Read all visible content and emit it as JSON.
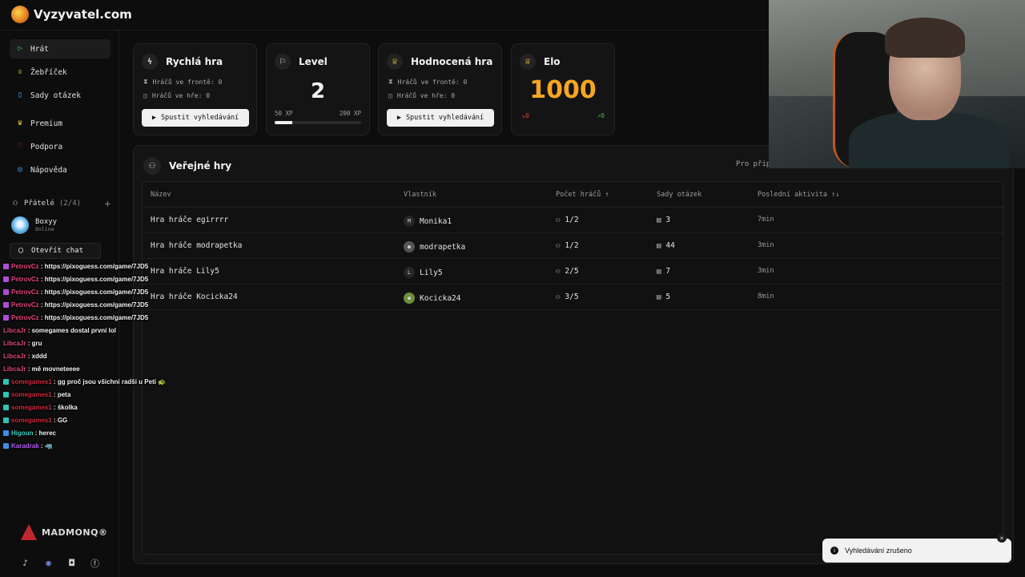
{
  "header": {
    "logo_text": "Vyzyvatel.com"
  },
  "sidebar": {
    "nav": [
      {
        "label": "Hrát",
        "icon": "play-icon"
      },
      {
        "label": "Žebříček",
        "icon": "trophy-icon"
      },
      {
        "label": "Sady otázek",
        "icon": "book-icon"
      },
      {
        "label": "Premium",
        "icon": "crown-icon"
      },
      {
        "label": "Podpora",
        "icon": "heart-icon"
      },
      {
        "label": "Nápověda",
        "icon": "help-icon"
      }
    ],
    "friends": {
      "label": "Přátelé",
      "count": "(2/4)"
    },
    "friend": {
      "name": "Boxyy",
      "status": "Online"
    },
    "open_chat": "Otevřít chat",
    "brand": "MADMONQ®"
  },
  "cards": {
    "quick": {
      "title": "Rychlá hra",
      "queue": "Hráčů ve frontě: 0",
      "in_game": "Hráčů ve hře: 0",
      "button": "Spustit vyhledávání"
    },
    "level": {
      "title": "Level",
      "value": "2",
      "xp_min": "50 XP",
      "xp_max": "200 XP",
      "progress": 0.2
    },
    "ranked": {
      "title": "Hodnocená hra",
      "queue": "Hráčů ve frontě: 0",
      "in_game": "Hráčů ve hře: 0",
      "button": "Spustit vyhledávání"
    },
    "elo": {
      "title": "Elo",
      "value": "1000",
      "down": "0",
      "up": "0"
    }
  },
  "games": {
    "title": "Veřejné hry",
    "note": "Pro přip",
    "columns": {
      "name": "Název",
      "owner": "Vlastník",
      "players": "Počet hráčů ↑",
      "sets": "Sady otázek",
      "activity": "Poslední aktivita ↑↓"
    },
    "rows": [
      {
        "name": "Hra hráče egirrrr",
        "owner_initial": "M",
        "owner": "Monika1",
        "players": "1/2",
        "sets": "3",
        "activity": "7min"
      },
      {
        "name": "Hra hráče modrapetka",
        "owner_initial": "●",
        "owner": "modrapetka",
        "players": "1/2",
        "sets": "44",
        "activity": "3min"
      },
      {
        "name": "Hra hráče Lily5",
        "owner_initial": "L",
        "owner": "Lily5",
        "players": "2/5",
        "sets": "7",
        "activity": "3min"
      },
      {
        "name": "Hra hráče Kocicka24",
        "owner_initial": "●",
        "owner": "Kocicka24",
        "players": "3/5",
        "sets": "5",
        "activity": "8min"
      }
    ]
  },
  "chat": [
    {
      "user": "PetrovCz",
      "color": "#e0457b",
      "badge": "#b04bd8",
      "text": ": https://pixoguess.com/game/7JD5"
    },
    {
      "user": "PetrovCz",
      "color": "#e0457b",
      "badge": "#b04bd8",
      "text": ": https://pixoguess.com/game/7JD5"
    },
    {
      "user": "PetrovCz",
      "color": "#e0457b",
      "badge": "#b04bd8",
      "text": ": https://pixoguess.com/game/7JD5"
    },
    {
      "user": "PetrovCz",
      "color": "#e0457b",
      "badge": "#b04bd8",
      "text": ": https://pixoguess.com/game/7JD5"
    },
    {
      "user": "PetrovCz",
      "color": "#e0457b",
      "badge": "#b04bd8",
      "text": ": https://pixoguess.com/game/7JD5"
    },
    {
      "user": "LibcaJr",
      "color": "#e0457b",
      "badge": "",
      "text": ": somegames dostal první lol"
    },
    {
      "user": "LibcaJr",
      "color": "#e0457b",
      "badge": "",
      "text": ": gru"
    },
    {
      "user": "LibcaJr",
      "color": "#e0457b",
      "badge": "",
      "text": ": xddd"
    },
    {
      "user": "LibcaJr",
      "color": "#e0457b",
      "badge": "",
      "text": ": mě movneteeee"
    },
    {
      "user": "somegames1",
      "color": "#d0283c",
      "badge": "#2ec4b6",
      "text": ": gg proč jsou všichni radši u Peti 🐢"
    },
    {
      "user": "somegames1",
      "color": "#d0283c",
      "badge": "#2ec4b6",
      "text": ": peta"
    },
    {
      "user": "somegames1",
      "color": "#d0283c",
      "badge": "#2ec4b6",
      "text": ": školka"
    },
    {
      "user": "somegames1",
      "color": "#d0283c",
      "badge": "#2ec4b6",
      "text": ": GG"
    },
    {
      "user": "Higoun",
      "color": "#3fd0c0",
      "badge": "#3a8ee6",
      "text": ": herec"
    },
    {
      "user": "Karadrak",
      "color": "#b15cf0",
      "badge": "#3a8ee6",
      "text": ": 🦏"
    }
  ],
  "toast": {
    "text": "Vyhledávání zrušeno"
  }
}
